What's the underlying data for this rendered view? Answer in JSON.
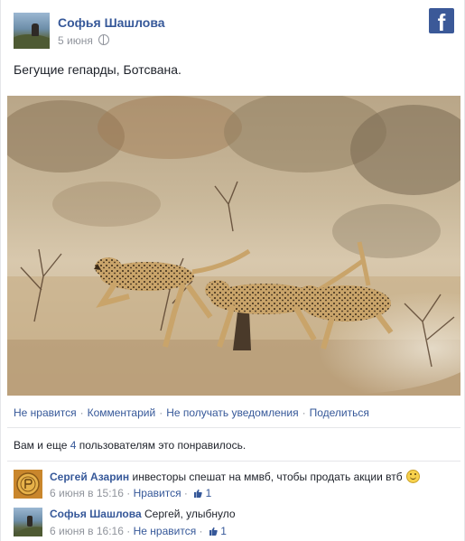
{
  "post": {
    "author": "Софья Шашлова",
    "date": "5 июня",
    "text": "Бегущие гепарды, Ботсвана.",
    "facebook_logo": "f"
  },
  "actions": {
    "unlike": "Не нравится",
    "comment": "Комментарий",
    "unfollow": "Не получать уведомления",
    "share": "Поделиться"
  },
  "likes": {
    "prefix": "Вам и еще ",
    "count": "4",
    "suffix": " пользователям это понравилось."
  },
  "comments": [
    {
      "author": "Сергей Азарин",
      "text": "инвесторы спешат на ммвб, чтобы продать акции втб",
      "time": "6 июня в 15:16",
      "like_label": "Нравится",
      "like_count": "1",
      "emoticon": "smile-icon"
    },
    {
      "author": "Софья Шашлова",
      "text": "Сергей, улыбнуло",
      "time": "6 июня в 16:16",
      "like_label": "Не нравится",
      "like_count": "1"
    }
  ],
  "colors": {
    "link": "#365899",
    "muted": "#90949c",
    "facebook": "#3b5998"
  }
}
